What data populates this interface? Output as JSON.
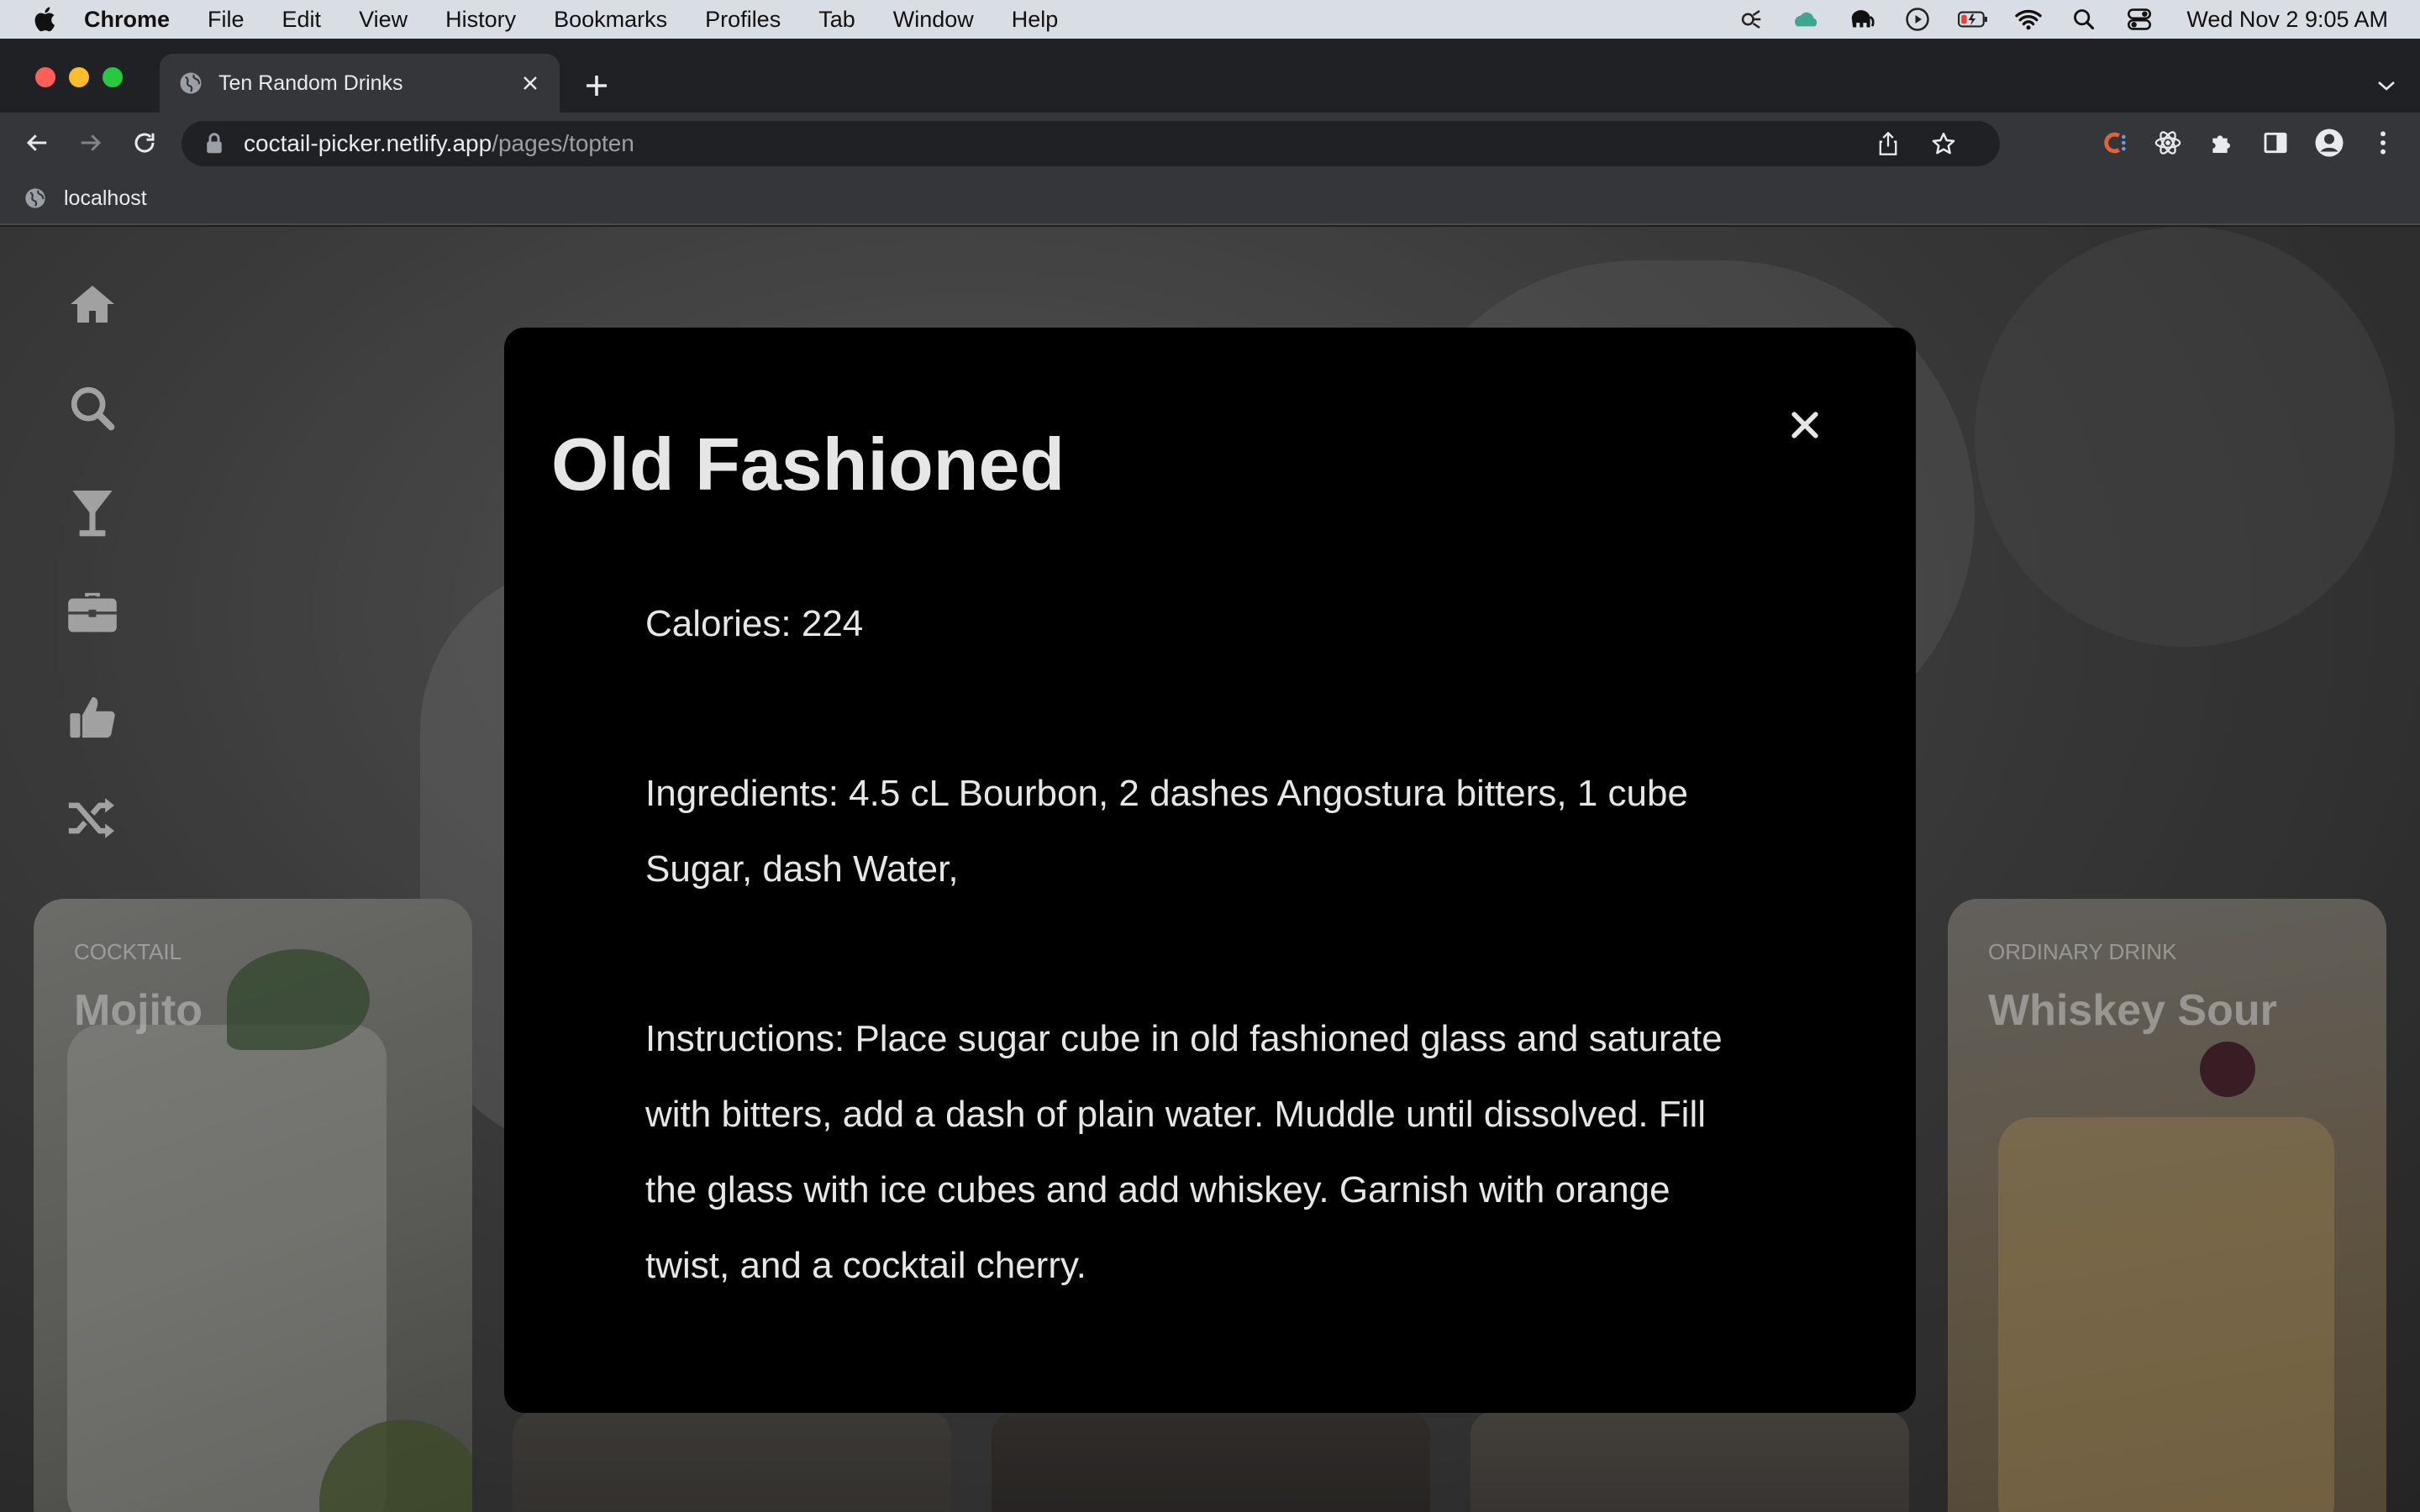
{
  "menubar": {
    "app_name": "Chrome",
    "items": [
      "File",
      "Edit",
      "View",
      "History",
      "Bookmarks",
      "Profiles",
      "Tab",
      "Window",
      "Help"
    ],
    "clock": "Wed Nov 2  9:05 AM"
  },
  "browser": {
    "tab_title": "Ten Random Drinks",
    "url_host": "coctail-picker.netlify.app",
    "url_path": "/pages/topten",
    "bookmark": "localhost"
  },
  "nav_icons": [
    "home-icon",
    "search-icon",
    "cocktail-icon",
    "briefcase-icon",
    "thumbs-up-icon",
    "shuffle-icon"
  ],
  "cards": {
    "left": {
      "category": "Cocktail",
      "name": "Mojito"
    },
    "right": {
      "category": "Ordinary Drink",
      "name": "Whiskey Sour"
    }
  },
  "modal": {
    "title": "Old Fashioned",
    "calories_label": "Calories: ",
    "calories_value": "224",
    "ingredients_label": "Ingredients: ",
    "ingredients_value": "4.5 cL Bourbon, 2 dashes Angostura bitters, 1 cube Sugar, dash Water,",
    "instructions_label": "Instructions: ",
    "instructions_value": "Place sugar cube in old fashioned glass and saturate with bitters, add a dash of plain water. Muddle until dissolved. Fill the glass with ice cubes and add whiskey. Garnish with orange twist, and a cocktail cherry."
  }
}
